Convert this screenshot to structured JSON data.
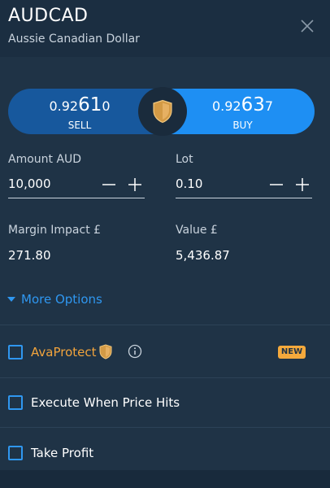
{
  "header": {
    "symbol": "AUDCAD",
    "name": "Aussie Canadian Dollar"
  },
  "trade": {
    "sell": {
      "price_prefix": "0.92",
      "price_big": "61",
      "price_suffix": "0",
      "label": "SELL"
    },
    "buy": {
      "price_prefix": "0.92",
      "price_big": "63",
      "price_suffix": "7",
      "label": "BUY"
    }
  },
  "amount": {
    "label": "Amount AUD",
    "value": "10,000"
  },
  "lot": {
    "label": "Lot",
    "value": "0.10"
  },
  "margin": {
    "label": "Margin Impact £",
    "value": "271.80"
  },
  "value": {
    "label": "Value £",
    "value": "5,436.87"
  },
  "more_options": {
    "label": "More Options"
  },
  "options": {
    "avaprotect": {
      "label": "AvaProtect",
      "badge": "NEW",
      "checked": false
    },
    "execute": {
      "label": "Execute When Price Hits",
      "checked": false
    },
    "take_profit": {
      "label": "Take Profit",
      "checked": false
    }
  },
  "colors": {
    "background": "#1f3346",
    "sell": "#17589d",
    "buy": "#1e8ff3",
    "accent": "#2f97f0",
    "avaprotect": "#f2a43c"
  },
  "icons": {
    "close": "close-icon",
    "shield": "shield-icon",
    "minus": "minus-icon",
    "plus": "plus-icon",
    "caret": "caret-down-icon",
    "info": "info-icon"
  }
}
